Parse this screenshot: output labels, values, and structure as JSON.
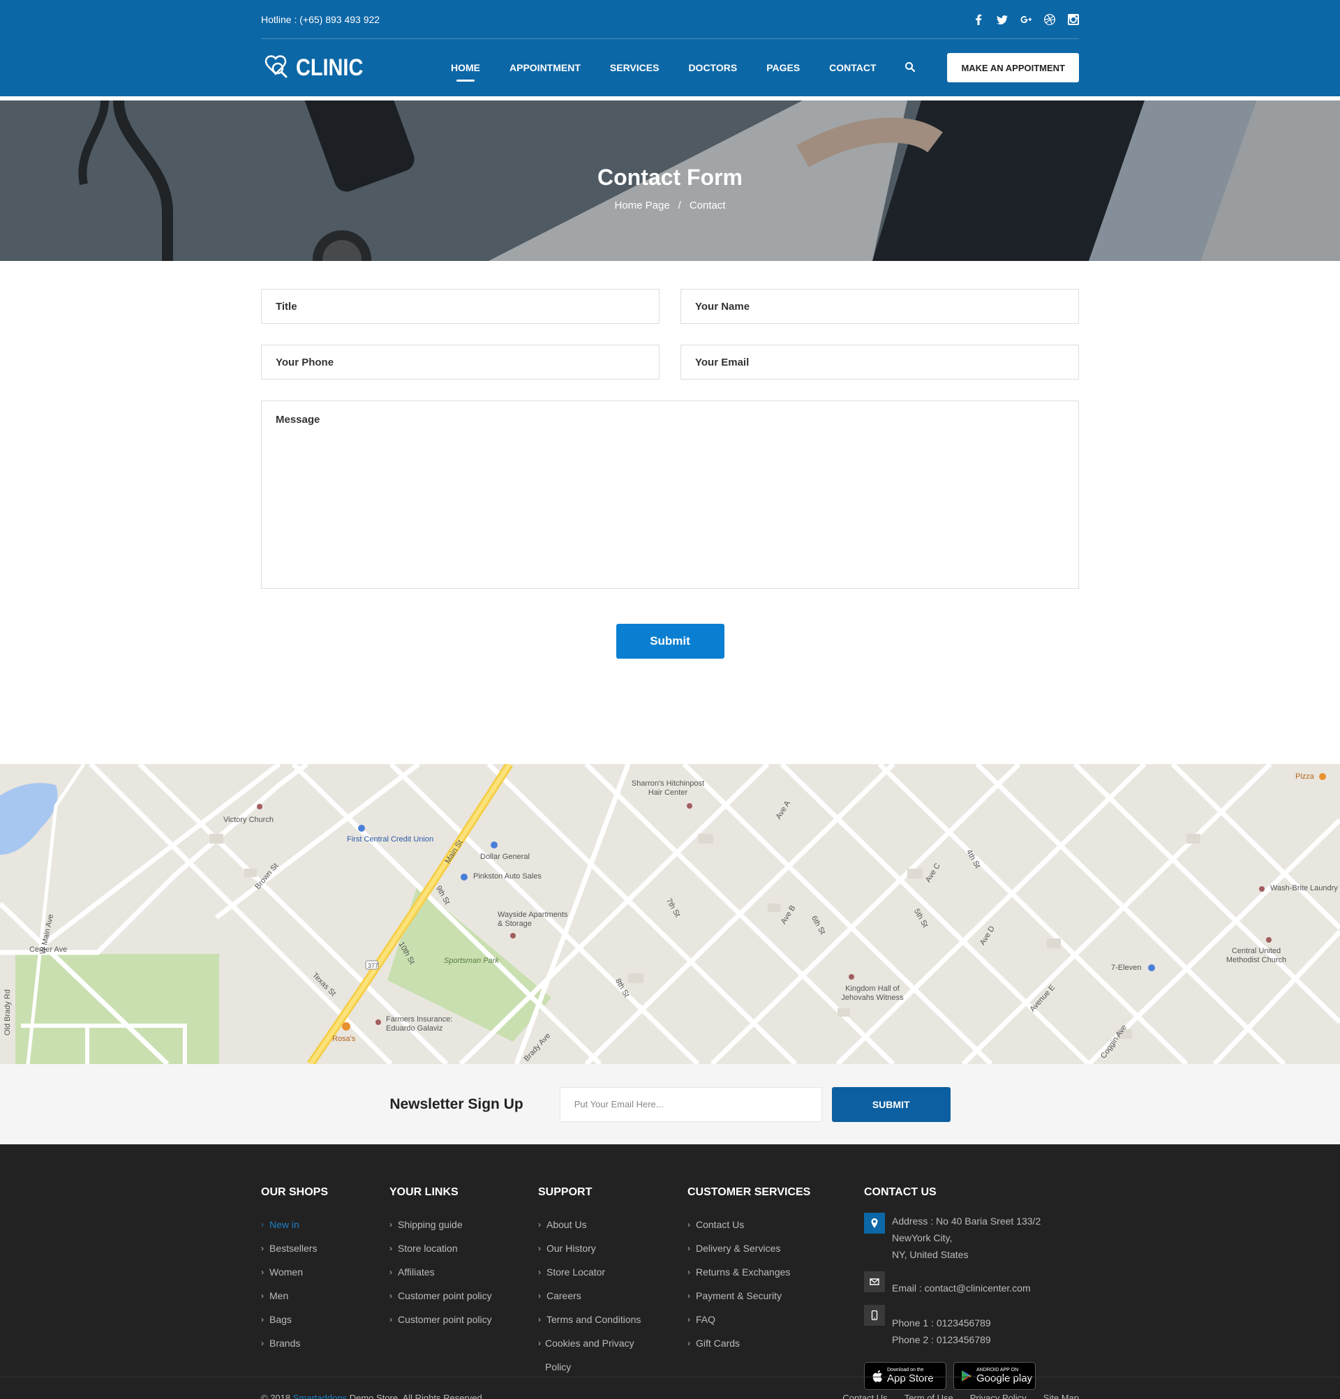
{
  "header": {
    "hotline": "Hotline : (+65) 893 493 922",
    "socials": [
      "facebook-icon",
      "twitter-icon",
      "google-plus-icon",
      "dribbble-icon",
      "instagram-icon"
    ],
    "logo_text": "CLINIC",
    "menu": [
      "HOME",
      "APPOINTMENT",
      "SERVICES",
      "DOCTORS",
      "PAGES",
      "CONTACT"
    ],
    "active_menu": "HOME",
    "cta": "MAKE AN APPOITMENT",
    "colors": {
      "primary": "#0c67a6",
      "accent": "#0a7fd2"
    }
  },
  "hero": {
    "title": "Contact Form",
    "breadcrumb": [
      "Home Page",
      "Contact"
    ],
    "separator": "/"
  },
  "form": {
    "title_placeholder": "Title",
    "name_placeholder": "Your Name",
    "phone_placeholder": "Your Phone",
    "email_placeholder": "Your Email",
    "message_placeholder": "Message",
    "submit": "Submit"
  },
  "map": {
    "labels": [
      "Victory Church",
      "First Central Credit Union",
      "Dollar General",
      "Pinkston Auto Sales",
      "Wayside Apartments & Storage",
      "Sharron's Hitchinpost Hair Center",
      "Sportsman Park",
      "Farmers Insurance: Eduardo Galaviz",
      "Rosa's",
      "Kingdom Hall of Jehovahs Witness",
      "7-Eleven",
      "Central United Methodist Church",
      "Wash-Brite Laundry",
      "Pizza",
      "Center Ave",
      "Main St",
      "Texas St",
      "Brown St",
      "W Main Ave",
      "Old Brady Rd",
      "Coggin Ave",
      "Brady Ave",
      "Avenue E",
      "4th St",
      "5th St",
      "6th St",
      "7th St",
      "8th St",
      "9th St",
      "10th St",
      "Ave A",
      "Ave B",
      "Ave C",
      "Ave D",
      "377"
    ]
  },
  "newsletter": {
    "title": "Newsletter Sign Up",
    "placeholder": "Put Your Email Here...",
    "button": "SUBMIT"
  },
  "footer": {
    "columns": [
      {
        "title": "OUR SHOPS",
        "items": [
          "New in",
          "Bestsellers",
          "Women",
          "Men",
          "Bags",
          "Brands"
        ]
      },
      {
        "title": "YOUR LINKS",
        "items": [
          "Shipping guide",
          "Store location",
          "Affiliates",
          "Customer point policy",
          "Customer point policy"
        ]
      },
      {
        "title": "SUPPORT",
        "items": [
          "About Us",
          "Our History",
          "Store Locator",
          "Careers",
          "Terms and Conditions",
          "Cookies and Privacy Policy"
        ]
      },
      {
        "title": "CUSTOMER SERVICES",
        "items": [
          "Contact Us",
          "Delivery & Services",
          "Returns & Exchanges",
          "Payment & Security",
          "FAQ",
          "Gift Cards"
        ]
      }
    ],
    "contact": {
      "title": "CONTACT US",
      "address_line1": "Address : No 40 Baria Sreet 133/2 NewYork City,",
      "address_line2": "NY, United States",
      "email": "Email : contact@clinicenter.com",
      "phone1": "Phone 1 : 0123456789",
      "phone2": "Phone 2 : 0123456789",
      "app_store_small": "Download on the",
      "app_store_big": "App Store",
      "google_small": "ANDROID APP ON",
      "google_big": "Google play"
    },
    "copyright_prefix": "© 2018",
    "copyright_brand": "Smartaddons",
    "copyright_suffix": "Demo Store. All Rights Reserved.",
    "bottom_links": [
      "Contact Us",
      "Term of Use",
      "Privacy Policy",
      "Site Map"
    ]
  }
}
